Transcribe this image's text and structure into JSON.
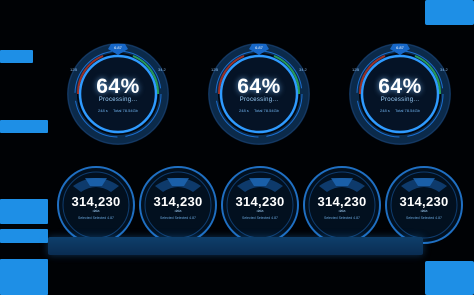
{
  "colors": {
    "accent": "#1e8fe6",
    "background": "#000205",
    "glow": "#2f9bff"
  },
  "gauges": [
    {
      "percent": "64%",
      "status": "Processing...",
      "stat_left": "248 s",
      "stat_right": "Total 78.54Gb",
      "badge": "6.87",
      "side_left": "12B",
      "side_right": "34.2"
    },
    {
      "percent": "64%",
      "status": "Processing...",
      "stat_left": "248 s",
      "stat_right": "Total 78.54Gb",
      "badge": "6.87",
      "side_left": "12B",
      "side_right": "34.2"
    },
    {
      "percent": "64%",
      "status": "Processing...",
      "stat_left": "248 s",
      "stat_right": "Total 78.54Gb",
      "badge": "6.87",
      "side_left": "12B",
      "side_right": "34.2"
    }
  ],
  "dials": [
    {
      "value": "314,230",
      "label": "data",
      "legend": "Selected   Selected 4.87"
    },
    {
      "value": "314,230",
      "label": "data",
      "legend": "Selected   Selected 4.87"
    },
    {
      "value": "314,230",
      "label": "data",
      "legend": "Selected   Selected 4.87"
    },
    {
      "value": "314,230",
      "label": "data",
      "legend": "Selected   Selected 4.87"
    },
    {
      "value": "314,230",
      "label": "data",
      "legend": "Selected   Selected 4.87"
    }
  ]
}
